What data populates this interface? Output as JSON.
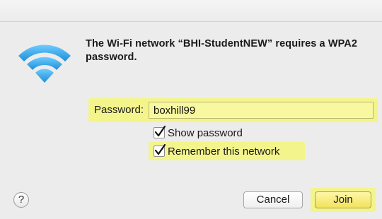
{
  "dialog": {
    "message": "The Wi-Fi network “BHI-StudentNEW” requires a WPA2 password.",
    "password_label": "Password:",
    "password_value": "boxhill99",
    "show_password_label": "Show password",
    "show_password_checked": true,
    "remember_label": "Remember this network",
    "remember_checked": true,
    "help_label": "?",
    "cancel_label": "Cancel",
    "join_label": "Join",
    "icon": "wifi-icon",
    "highlight_color": "#f4f48d",
    "accent_color": "#2aa7ea"
  }
}
